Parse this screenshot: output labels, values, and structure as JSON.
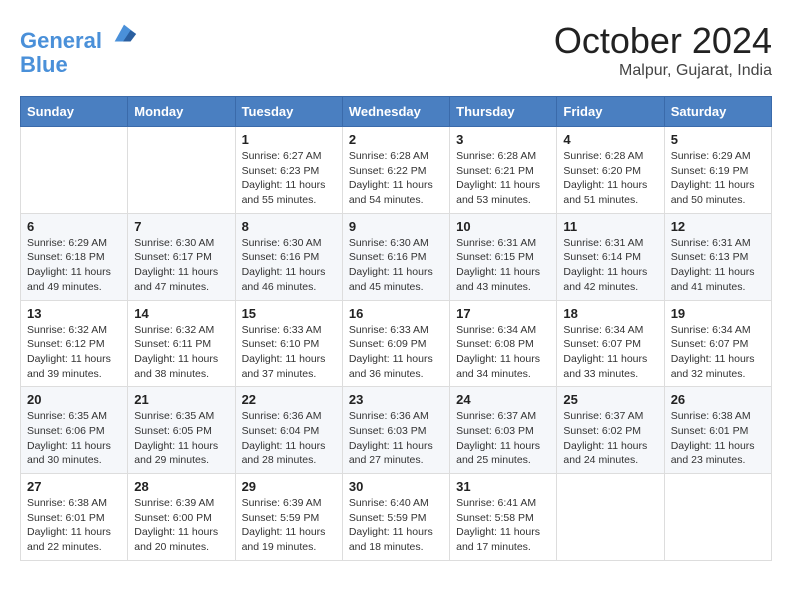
{
  "header": {
    "logo_line1": "General",
    "logo_line2": "Blue",
    "month": "October 2024",
    "location": "Malpur, Gujarat, India"
  },
  "weekdays": [
    "Sunday",
    "Monday",
    "Tuesday",
    "Wednesday",
    "Thursday",
    "Friday",
    "Saturday"
  ],
  "weeks": [
    [
      {
        "day": "",
        "info": ""
      },
      {
        "day": "",
        "info": ""
      },
      {
        "day": "1",
        "info": "Sunrise: 6:27 AM\nSunset: 6:23 PM\nDaylight: 11 hours and 55 minutes."
      },
      {
        "day": "2",
        "info": "Sunrise: 6:28 AM\nSunset: 6:22 PM\nDaylight: 11 hours and 54 minutes."
      },
      {
        "day": "3",
        "info": "Sunrise: 6:28 AM\nSunset: 6:21 PM\nDaylight: 11 hours and 53 minutes."
      },
      {
        "day": "4",
        "info": "Sunrise: 6:28 AM\nSunset: 6:20 PM\nDaylight: 11 hours and 51 minutes."
      },
      {
        "day": "5",
        "info": "Sunrise: 6:29 AM\nSunset: 6:19 PM\nDaylight: 11 hours and 50 minutes."
      }
    ],
    [
      {
        "day": "6",
        "info": "Sunrise: 6:29 AM\nSunset: 6:18 PM\nDaylight: 11 hours and 49 minutes."
      },
      {
        "day": "7",
        "info": "Sunrise: 6:30 AM\nSunset: 6:17 PM\nDaylight: 11 hours and 47 minutes."
      },
      {
        "day": "8",
        "info": "Sunrise: 6:30 AM\nSunset: 6:16 PM\nDaylight: 11 hours and 46 minutes."
      },
      {
        "day": "9",
        "info": "Sunrise: 6:30 AM\nSunset: 6:16 PM\nDaylight: 11 hours and 45 minutes."
      },
      {
        "day": "10",
        "info": "Sunrise: 6:31 AM\nSunset: 6:15 PM\nDaylight: 11 hours and 43 minutes."
      },
      {
        "day": "11",
        "info": "Sunrise: 6:31 AM\nSunset: 6:14 PM\nDaylight: 11 hours and 42 minutes."
      },
      {
        "day": "12",
        "info": "Sunrise: 6:31 AM\nSunset: 6:13 PM\nDaylight: 11 hours and 41 minutes."
      }
    ],
    [
      {
        "day": "13",
        "info": "Sunrise: 6:32 AM\nSunset: 6:12 PM\nDaylight: 11 hours and 39 minutes."
      },
      {
        "day": "14",
        "info": "Sunrise: 6:32 AM\nSunset: 6:11 PM\nDaylight: 11 hours and 38 minutes."
      },
      {
        "day": "15",
        "info": "Sunrise: 6:33 AM\nSunset: 6:10 PM\nDaylight: 11 hours and 37 minutes."
      },
      {
        "day": "16",
        "info": "Sunrise: 6:33 AM\nSunset: 6:09 PM\nDaylight: 11 hours and 36 minutes."
      },
      {
        "day": "17",
        "info": "Sunrise: 6:34 AM\nSunset: 6:08 PM\nDaylight: 11 hours and 34 minutes."
      },
      {
        "day": "18",
        "info": "Sunrise: 6:34 AM\nSunset: 6:07 PM\nDaylight: 11 hours and 33 minutes."
      },
      {
        "day": "19",
        "info": "Sunrise: 6:34 AM\nSunset: 6:07 PM\nDaylight: 11 hours and 32 minutes."
      }
    ],
    [
      {
        "day": "20",
        "info": "Sunrise: 6:35 AM\nSunset: 6:06 PM\nDaylight: 11 hours and 30 minutes."
      },
      {
        "day": "21",
        "info": "Sunrise: 6:35 AM\nSunset: 6:05 PM\nDaylight: 11 hours and 29 minutes."
      },
      {
        "day": "22",
        "info": "Sunrise: 6:36 AM\nSunset: 6:04 PM\nDaylight: 11 hours and 28 minutes."
      },
      {
        "day": "23",
        "info": "Sunrise: 6:36 AM\nSunset: 6:03 PM\nDaylight: 11 hours and 27 minutes."
      },
      {
        "day": "24",
        "info": "Sunrise: 6:37 AM\nSunset: 6:03 PM\nDaylight: 11 hours and 25 minutes."
      },
      {
        "day": "25",
        "info": "Sunrise: 6:37 AM\nSunset: 6:02 PM\nDaylight: 11 hours and 24 minutes."
      },
      {
        "day": "26",
        "info": "Sunrise: 6:38 AM\nSunset: 6:01 PM\nDaylight: 11 hours and 23 minutes."
      }
    ],
    [
      {
        "day": "27",
        "info": "Sunrise: 6:38 AM\nSunset: 6:01 PM\nDaylight: 11 hours and 22 minutes."
      },
      {
        "day": "28",
        "info": "Sunrise: 6:39 AM\nSunset: 6:00 PM\nDaylight: 11 hours and 20 minutes."
      },
      {
        "day": "29",
        "info": "Sunrise: 6:39 AM\nSunset: 5:59 PM\nDaylight: 11 hours and 19 minutes."
      },
      {
        "day": "30",
        "info": "Sunrise: 6:40 AM\nSunset: 5:59 PM\nDaylight: 11 hours and 18 minutes."
      },
      {
        "day": "31",
        "info": "Sunrise: 6:41 AM\nSunset: 5:58 PM\nDaylight: 11 hours and 17 minutes."
      },
      {
        "day": "",
        "info": ""
      },
      {
        "day": "",
        "info": ""
      }
    ]
  ]
}
